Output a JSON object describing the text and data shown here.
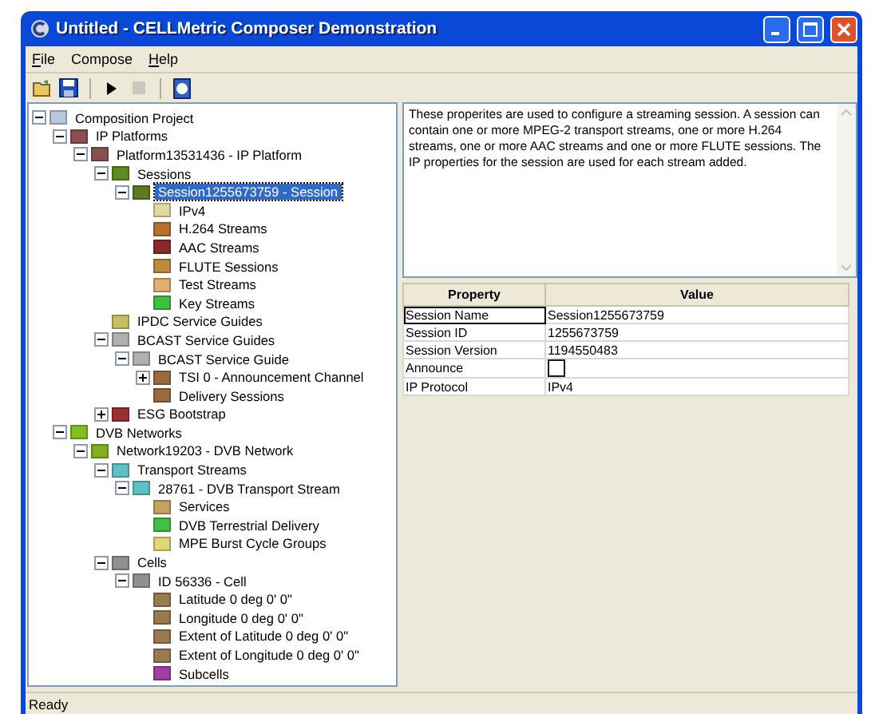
{
  "window": {
    "title": "Untitled - CELLMetric Composer Demonstration"
  },
  "menu": [
    {
      "label": "File",
      "mnemonic": true
    },
    {
      "label": "Compose",
      "mnemonic": false
    },
    {
      "label": "Help",
      "mnemonic": true
    }
  ],
  "toolbar": [
    {
      "kind": "open",
      "disabled": false
    },
    {
      "kind": "save",
      "disabled": false
    },
    {
      "kind": "separator"
    },
    {
      "kind": "play",
      "disabled": false
    },
    {
      "kind": "stop",
      "disabled": true
    },
    {
      "kind": "separator"
    },
    {
      "kind": "help",
      "disabled": false
    }
  ],
  "tree": [
    {
      "label": "Composition Project",
      "color": "#b8c8dc",
      "expanded": true,
      "selected": false,
      "children": [
        {
          "label": "IP Platforms",
          "color": "#8a5050",
          "expanded": true,
          "selected": false,
          "children": [
            {
              "label": "Platform13531436 - IP Platform",
              "color": "#8a5050",
              "expanded": true,
              "selected": false,
              "children": [
                {
                  "label": "Sessions",
                  "color": "#5f8a20",
                  "expanded": true,
                  "selected": false,
                  "children": [
                    {
                      "label": "Session1255673759 - Session",
                      "color": "#5f7a20",
                      "expanded": true,
                      "selected": true,
                      "children": [
                        {
                          "label": "IPv4",
                          "color": "#e0d8a0",
                          "selected": false
                        },
                        {
                          "label": "H.264 Streams",
                          "color": "#b87030",
                          "selected": false
                        },
                        {
                          "label": "AAC Streams",
                          "color": "#8b2a2a",
                          "selected": false
                        },
                        {
                          "label": "FLUTE Sessions",
                          "color": "#c08a40",
                          "selected": false
                        },
                        {
                          "label": "Test Streams",
                          "color": "#e0b070",
                          "selected": false
                        },
                        {
                          "label": "Key Streams",
                          "color": "#40c040",
                          "selected": false
                        }
                      ]
                    }
                  ]
                },
                {
                  "label": "IPDC Service Guides",
                  "color": "#c8c060",
                  "selected": false
                },
                {
                  "label": "BCAST Service Guides",
                  "color": "#b0b0b0",
                  "expanded": true,
                  "selected": false,
                  "children": [
                    {
                      "label": "BCAST Service Guide",
                      "color": "#b0b0b0",
                      "expanded": true,
                      "selected": false,
                      "children": [
                        {
                          "label": "TSI 0 - Announcement Channel",
                          "color": "#9a6a40",
                          "expanded": false,
                          "selected": false
                        },
                        {
                          "label": "Delivery Sessions",
                          "color": "#9a6a40",
                          "selected": false
                        }
                      ]
                    }
                  ]
                },
                {
                  "label": "ESG Bootstrap",
                  "color": "#9a3030",
                  "expanded": false,
                  "selected": false
                }
              ]
            }
          ]
        },
        {
          "label": "DVB Networks",
          "color": "#80c020",
          "expanded": true,
          "selected": false,
          "children": [
            {
              "label": "Network19203 - DVB Network",
              "color": "#80b020",
              "expanded": true,
              "selected": false,
              "children": [
                {
                  "label": "Transport Streams",
                  "color": "#60c0c8",
                  "expanded": true,
                  "selected": false,
                  "children": [
                    {
                      "label": "28761 - DVB Transport Stream",
                      "color": "#60c0c8",
                      "expanded": true,
                      "selected": false,
                      "children": [
                        {
                          "label": "Services",
                          "color": "#c8a060",
                          "selected": false
                        },
                        {
                          "label": "DVB Terrestrial Delivery",
                          "color": "#40c040",
                          "selected": false
                        },
                        {
                          "label": "MPE Burst Cycle Groups",
                          "color": "#e0d870",
                          "selected": false
                        }
                      ]
                    }
                  ]
                },
                {
                  "label": "Cells",
                  "color": "#909090",
                  "expanded": true,
                  "selected": false,
                  "children": [
                    {
                      "label": "ID 56336 - Cell",
                      "color": "#909090",
                      "expanded": true,
                      "selected": false,
                      "children": [
                        {
                          "label": "Latitude 0 deg 0' 0\"",
                          "color": "#9a7a50",
                          "selected": false
                        },
                        {
                          "label": "Longitude 0 deg 0' 0\"",
                          "color": "#9a7a50",
                          "selected": false
                        },
                        {
                          "label": "Extent of Latitude 0 deg 0' 0\"",
                          "color": "#9a7a50",
                          "selected": false
                        },
                        {
                          "label": "Extent of Longitude 0 deg 0' 0\"",
                          "color": "#9a7a50",
                          "selected": false
                        },
                        {
                          "label": "Subcells",
                          "color": "#a040a0",
                          "selected": false
                        }
                      ]
                    }
                  ]
                }
              ]
            }
          ]
        }
      ]
    }
  ],
  "description": "These properites are used to configure a streaming session.  A session can contain one or more MPEG-2 transport streams, one or more H.264 streams, one or more AAC streams and one or more FLUTE sessions.  The IP properties for the session are used for each stream added.",
  "properties": {
    "columns": [
      "Property",
      "Value"
    ],
    "rows": [
      {
        "name": "Session Name",
        "kind": "text",
        "value": "Session1255673759",
        "focused": true
      },
      {
        "name": "Session ID",
        "kind": "text",
        "value": "1255673759",
        "focused": false
      },
      {
        "name": "Session Version",
        "kind": "text",
        "value": "1194550483",
        "focused": false
      },
      {
        "name": "Announce",
        "kind": "checkbox",
        "checked": false,
        "focused": false
      },
      {
        "name": "IP Protocol",
        "kind": "text",
        "value": "IPv4",
        "focused": false
      }
    ]
  },
  "status_bar": "Ready"
}
